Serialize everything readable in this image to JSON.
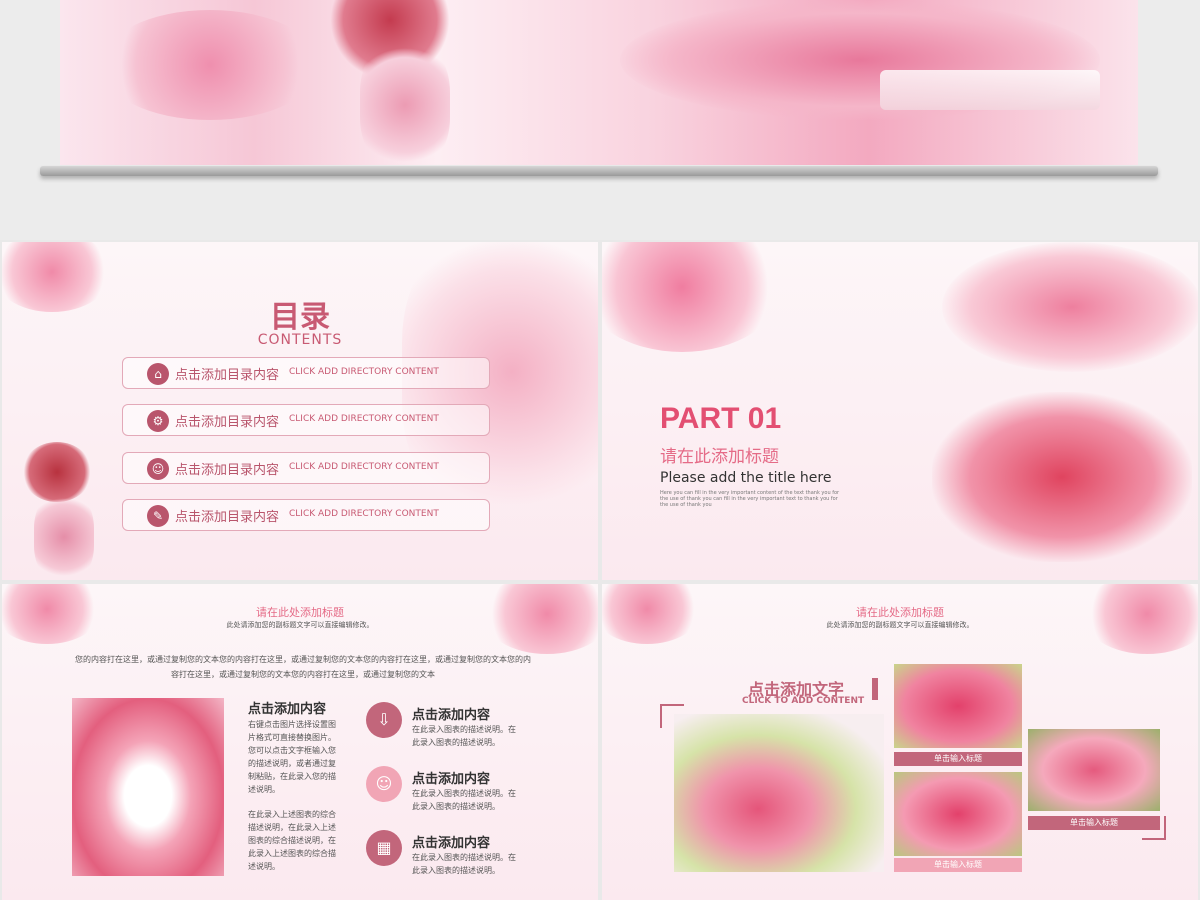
{
  "slide_toc": {
    "title": "目录",
    "subtitle": "CONTENTS",
    "items": [
      {
        "icon": "home-icon",
        "glyph": "⌂",
        "cn": "点击添加目录内容",
        "en": "CLICK ADD DIRECTORY CONTENT"
      },
      {
        "icon": "gear-icon",
        "glyph": "⚙",
        "cn": "点击添加目录内容",
        "en": "CLICK ADD DIRECTORY CONTENT"
      },
      {
        "icon": "users-icon",
        "glyph": "☺",
        "cn": "点击添加目录内容",
        "en": "CLICK ADD DIRECTORY CONTENT"
      },
      {
        "icon": "pen-icon",
        "glyph": "✎",
        "cn": "点击添加目录内容",
        "en": "CLICK ADD DIRECTORY CONTENT"
      }
    ]
  },
  "slide_part": {
    "part": "PART 01",
    "title_cn": "请在此添加标题",
    "title_en": "Please add the title here",
    "small": "Here you can fill in the very important content of the text thank you for the use of thank you can fill in the very important text to thank you for the use of thank you"
  },
  "slide_content": {
    "header_title": "请在此处添加标题",
    "header_sub": "此处请添加您的副标题文字可以直接编辑修改。",
    "paragraph": "您的内容打在这里，或通过复制您的文本您的内容打在这里，或通过复制您的文本您的内容打在这里，或通过复制您的文本您的内容打在这里，或通过复制您的文本您的内容打在这里，或通过复制您的文本",
    "left_title": "点击添加内容",
    "left_text": "右键点击图片选择设置图片格式可直接替换图片。您可以点击文字框输入您的描述说明，或者通过复制粘贴，在此录入您的描述说明。",
    "left_text2": "在此录入上述图表的综合描述说明，在此录入上述图表的综合描述说明，在此录入上述图表的综合描述说明。",
    "items": [
      {
        "icon": "download-icon",
        "glyph": "⇩",
        "title": "点击添加内容",
        "text": "在此录入图表的描述说明。在此录入图表的描述说明。"
      },
      {
        "icon": "users-icon",
        "glyph": "☺",
        "title": "点击添加内容",
        "text": "在此录入图表的描述说明。在此录入图表的描述说明。"
      },
      {
        "icon": "calendar-icon",
        "glyph": "▦",
        "title": "点击添加内容",
        "text": "在此录入图表的描述说明。在此录入图表的描述说明。"
      }
    ]
  },
  "slide_gallery": {
    "header_title": "请在此处添加标题",
    "header_sub": "此处请添加您的副标题文字可以直接编辑修改。",
    "click_cn": "点击添加文字",
    "click_en": "CLICK TO ADD CONTENT",
    "captions": [
      "单击输入标题",
      "单击输入标题",
      "单击输入标题"
    ]
  },
  "colors": {
    "accent": "#e34f72",
    "rose": "#c2667b",
    "pink_bg": "#fbe9ef"
  }
}
